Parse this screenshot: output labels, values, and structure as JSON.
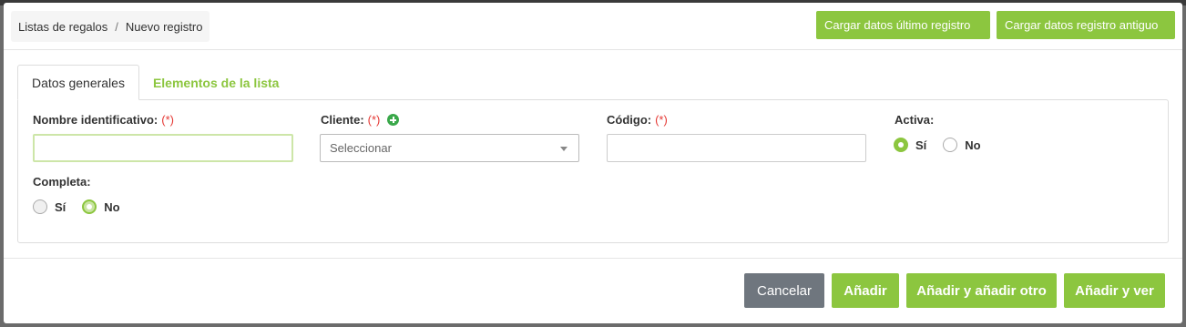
{
  "breadcrumb": {
    "items": [
      "Listas de regalos",
      "Nuevo registro"
    ],
    "separator": "/"
  },
  "header_buttons": {
    "load_last": "Cargar datos último registro",
    "load_old": "Cargar datos registro antiguo"
  },
  "tabs": [
    {
      "label": "Datos generales",
      "active": true
    },
    {
      "label": "Elementos de la lista",
      "active": false
    }
  ],
  "form": {
    "required_mark": "(*)",
    "nombre": {
      "label": "Nombre identificativo:",
      "value": ""
    },
    "cliente": {
      "label": "Cliente:",
      "placeholder": "Seleccionar"
    },
    "codigo": {
      "label": "Código:",
      "value": ""
    },
    "activa": {
      "label": "Activa:",
      "options": [
        "Sí",
        "No"
      ],
      "selected": "Sí"
    },
    "completa": {
      "label": "Completa:",
      "options": [
        "Sí",
        "No"
      ],
      "selected": "No"
    }
  },
  "footer": {
    "cancel": "Cancelar",
    "add": "Añadir",
    "add_another": "Añadir y añadir otro",
    "add_view": "Añadir y ver"
  },
  "colors": {
    "accent": "#8cc63f",
    "cancel": "#6f767e",
    "required": "#e53935",
    "add_icon": "#3aa84a"
  },
  "icons": {
    "add_client": "plus-circle-icon",
    "dropdown": "caret-down-icon"
  }
}
